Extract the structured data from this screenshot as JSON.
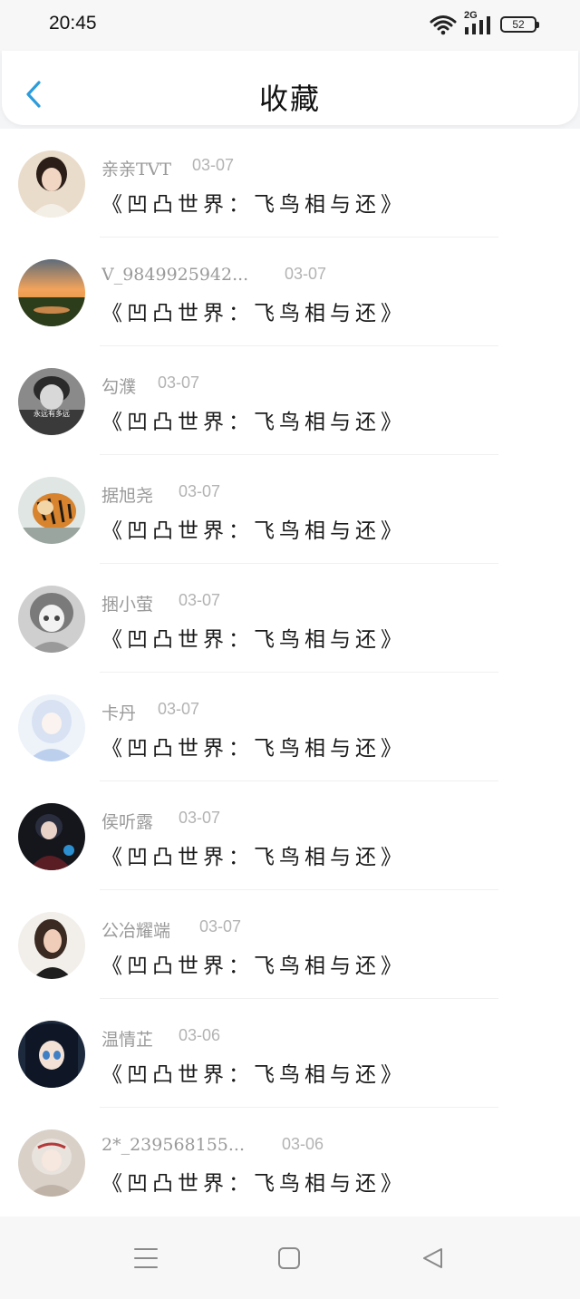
{
  "status_bar": {
    "time": "20:45",
    "network": "2G",
    "battery": "52",
    "icons": [
      "wifi-icon",
      "signal-icon",
      "battery-icon"
    ]
  },
  "header": {
    "title": "收藏",
    "back_icon": "chevron-left-icon",
    "accent_color": "#2d9cdb"
  },
  "list": {
    "items": [
      {
        "name": "亲亲TVT",
        "date": "03-07",
        "title": "《凹凸世界：飞鸟相与还》",
        "avatar": "avatar-1"
      },
      {
        "name": "V_9849925942...",
        "date": "03-07",
        "title": "《凹凸世界：飞鸟相与还》",
        "avatar": "avatar-2"
      },
      {
        "name": "勾濮",
        "date": "03-07",
        "title": "《凹凸世界：飞鸟相与还》",
        "avatar": "avatar-3",
        "avatar_caption": "永远有多远"
      },
      {
        "name": "据旭尧",
        "date": "03-07",
        "title": "《凹凸世界：飞鸟相与还》",
        "avatar": "avatar-4"
      },
      {
        "name": "捆小萤",
        "date": "03-07",
        "title": "《凹凸世界：飞鸟相与还》",
        "avatar": "avatar-5"
      },
      {
        "name": "卡丹",
        "date": "03-07",
        "title": "《凹凸世界：飞鸟相与还》",
        "avatar": "avatar-6"
      },
      {
        "name": "侯听露",
        "date": "03-07",
        "title": "《凹凸世界：飞鸟相与还》",
        "avatar": "avatar-7"
      },
      {
        "name": "公冶耀端",
        "date": "03-07",
        "title": "《凹凸世界：飞鸟相与还》",
        "avatar": "avatar-8"
      },
      {
        "name": "温情芷",
        "date": "03-06",
        "title": "《凹凸世界：飞鸟相与还》",
        "avatar": "avatar-9"
      },
      {
        "name": "2*_239568155...",
        "date": "03-06",
        "title": "《凹凸世界：飞鸟相与还》",
        "avatar": "avatar-10"
      }
    ]
  },
  "system_nav": {
    "icons": [
      "menu-icon",
      "home-icon",
      "back-icon"
    ]
  }
}
